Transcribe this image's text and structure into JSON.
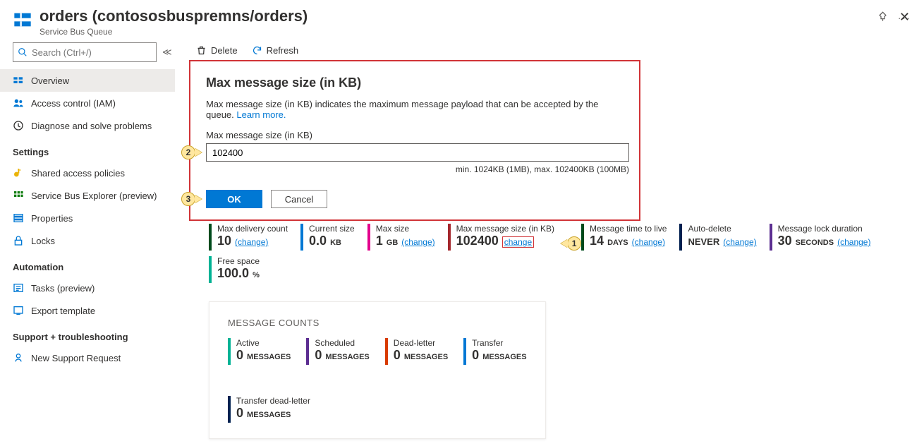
{
  "header": {
    "title": "orders (contososbuspremns/orders)",
    "subtitle": "Service Bus Queue"
  },
  "search": {
    "placeholder": "Search (Ctrl+/)"
  },
  "nav": {
    "overview": "Overview",
    "access": "Access control (IAM)",
    "diagnose": "Diagnose and solve problems",
    "section_settings": "Settings",
    "shared": "Shared access policies",
    "explorer": "Service Bus Explorer (preview)",
    "properties": "Properties",
    "locks": "Locks",
    "section_automation": "Automation",
    "tasks": "Tasks (preview)",
    "export": "Export template",
    "section_support": "Support + troubleshooting",
    "support": "New Support Request"
  },
  "toolbar": {
    "delete": "Delete",
    "refresh": "Refresh"
  },
  "dialog": {
    "title": "Max message size (in KB)",
    "desc_pre": "Max message size (in KB) indicates the maximum message payload that can be accepted by the queue. ",
    "learn": "Learn more.",
    "field_label": "Max message size (in KB)",
    "field_value": "102400",
    "hint": "min. 1024KB (1MB), max. 102400KB (100MB)",
    "ok": "OK",
    "cancel": "Cancel"
  },
  "callouts": {
    "one": "1",
    "two": "2",
    "three": "3"
  },
  "metrics": {
    "change": "(change)",
    "max_delivery": {
      "label": "Max delivery count",
      "value": "10"
    },
    "current_size": {
      "label": "Current size",
      "value": "0.0",
      "unit": "KB"
    },
    "max_size": {
      "label": "Max size",
      "value": "1",
      "unit": "GB"
    },
    "max_msg": {
      "label": "Max message size (in KB)",
      "value": "102400",
      "change": "change"
    },
    "ttl": {
      "label": "Message time to live",
      "value": "14",
      "unit": "DAYS"
    },
    "auto_delete": {
      "label": "Auto-delete",
      "value": "NEVER"
    },
    "lock": {
      "label": "Message lock duration",
      "value": "30",
      "unit": "SECONDS"
    },
    "free_space": {
      "label": "Free space",
      "value": "100.0",
      "unit": "%"
    }
  },
  "counts_card": {
    "title": "MESSAGE COUNTS",
    "unit": "MESSAGES",
    "active": {
      "label": "Active",
      "value": "0"
    },
    "scheduled": {
      "label": "Scheduled",
      "value": "0"
    },
    "dead": {
      "label": "Dead-letter",
      "value": "0"
    },
    "transfer": {
      "label": "Transfer",
      "value": "0"
    },
    "transfer_dead": {
      "label": "Transfer dead-letter",
      "value": "0"
    }
  }
}
